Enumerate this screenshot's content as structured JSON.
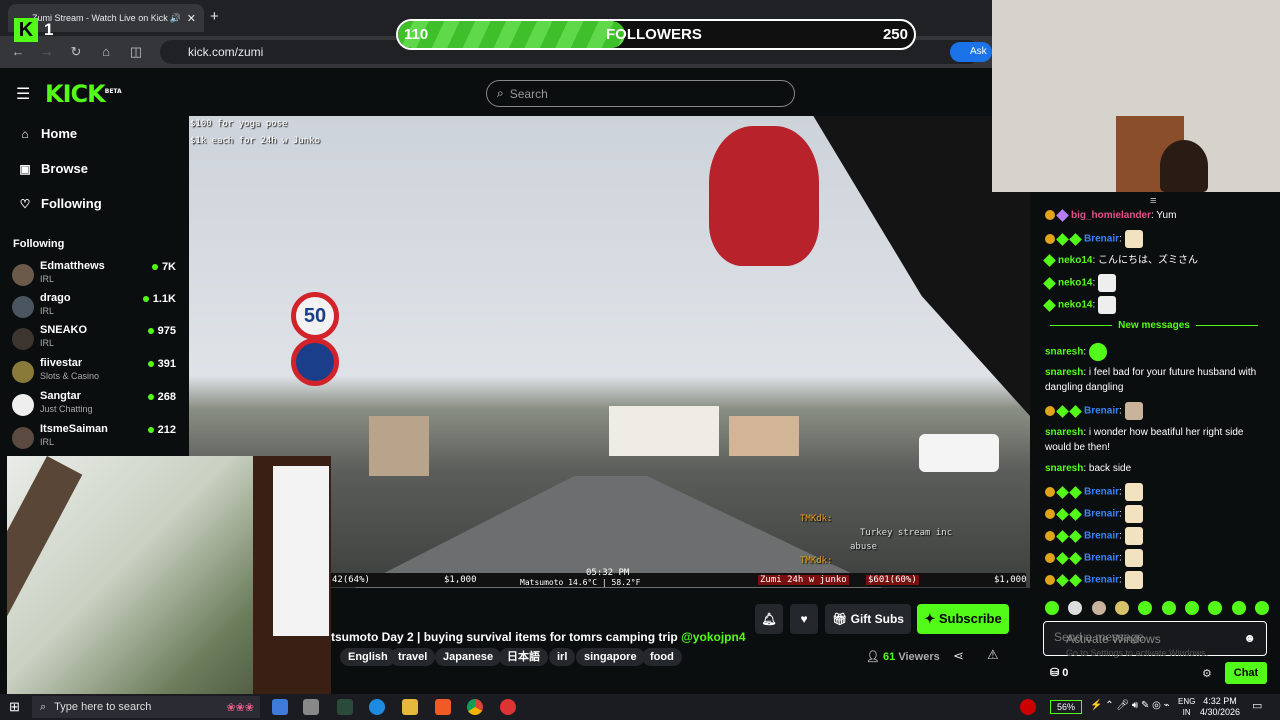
{
  "browser": {
    "tab_title": "Zumi Stream - Watch Live on Kick",
    "new_tab": "+",
    "url": "kick.com/zumi",
    "ask": "Ask"
  },
  "overlay": {
    "kick_count": "1",
    "followers_current": "110",
    "followers_label": "FOLLOWERS",
    "followers_goal": "250",
    "followers_progress": 0.44
  },
  "header": {
    "logo": "KICK",
    "logo_badge": "BETA",
    "search_placeholder": "Search"
  },
  "sidebar": {
    "nav": [
      {
        "label": "Home",
        "icon": "home-icon"
      },
      {
        "label": "Browse",
        "icon": "browse-icon"
      },
      {
        "label": "Following",
        "icon": "heart-icon"
      }
    ],
    "following_heading": "Following",
    "following": [
      {
        "name": "Edmatthews",
        "category": "IRL",
        "viewers": "7K"
      },
      {
        "name": "drago",
        "category": "IRL",
        "viewers": "1.1K"
      },
      {
        "name": "SNEAKO",
        "category": "IRL",
        "viewers": "975"
      },
      {
        "name": "fiivestar",
        "category": "Slots & Casino",
        "viewers": "391"
      },
      {
        "name": "Sangtar",
        "category": "Just Chatting",
        "viewers": "268"
      },
      {
        "name": "ItsmeSaiman",
        "category": "IRL",
        "viewers": "212"
      }
    ]
  },
  "video": {
    "overlay_lines": [
      "$100 for yoga pose",
      "$1k each for 24h w Junko"
    ],
    "sign_speed": "50",
    "bar_left": "42(64%)",
    "bar_price1": "$1,000",
    "bar_time": "05:32 PM",
    "bar_location": "Matsumoto 14.6°C | 58.2°F",
    "bar_goal": "Zumi 24h w junko",
    "bar_goal_amount": "$601(60%)",
    "bar_price2": "$1,000",
    "chat_lines": [
      "TMKdk:",
      "Turkey stream inc",
      "abuse",
      "TMKdk:"
    ]
  },
  "stream": {
    "title": "tsumoto Day 2 | buying survival items for tomrs camping trip",
    "mention": "@yokojpn4",
    "tags": [
      "English",
      "travel",
      "Japanese",
      "日本語",
      "irl",
      "singapore",
      "food"
    ],
    "viewers_count": "61",
    "viewers_label": "Viewers",
    "gift_subs": "Gift Subs",
    "subscribe": "Subscribe"
  },
  "chat": {
    "messages": [
      {
        "user": "big_homielander",
        "text": ": Yum"
      },
      {
        "user": "Brenair",
        "text": ":"
      },
      {
        "user": "neko14",
        "text": ": こんにちは、ズミさん"
      },
      {
        "user": "neko14",
        "text": ":"
      },
      {
        "user": "neko14",
        "text": ":"
      },
      {
        "user": "snaresh",
        "text": ":"
      },
      {
        "user": "snaresh",
        "text": ": i feel bad for your future husband with dangling dangling"
      },
      {
        "user": "Brenair",
        "text": ":"
      },
      {
        "user": "snaresh",
        "text": ": i wonder how beatiful her right side would be then!"
      },
      {
        "user": "snaresh",
        "text": ": back side"
      },
      {
        "user": "Brenair",
        "text": ":"
      },
      {
        "user": "Brenair",
        "text": ":"
      },
      {
        "user": "Brenair",
        "text": ":"
      },
      {
        "user": "Brenair",
        "text": ":"
      },
      {
        "user": "Brenair",
        "text": ":"
      }
    ],
    "new_messages": "New messages",
    "input_placeholder": "Send a message",
    "windows_watermark": "Go to Settings to activate Windows.",
    "activate_text": "Activate Windows",
    "points": "0",
    "chat_button": "Chat"
  },
  "taskbar": {
    "search_placeholder": "Type here to search",
    "battery": "56%",
    "lang": "ENG",
    "region": "IN",
    "time": "4:32 PM",
    "date": "4/30/2026"
  }
}
